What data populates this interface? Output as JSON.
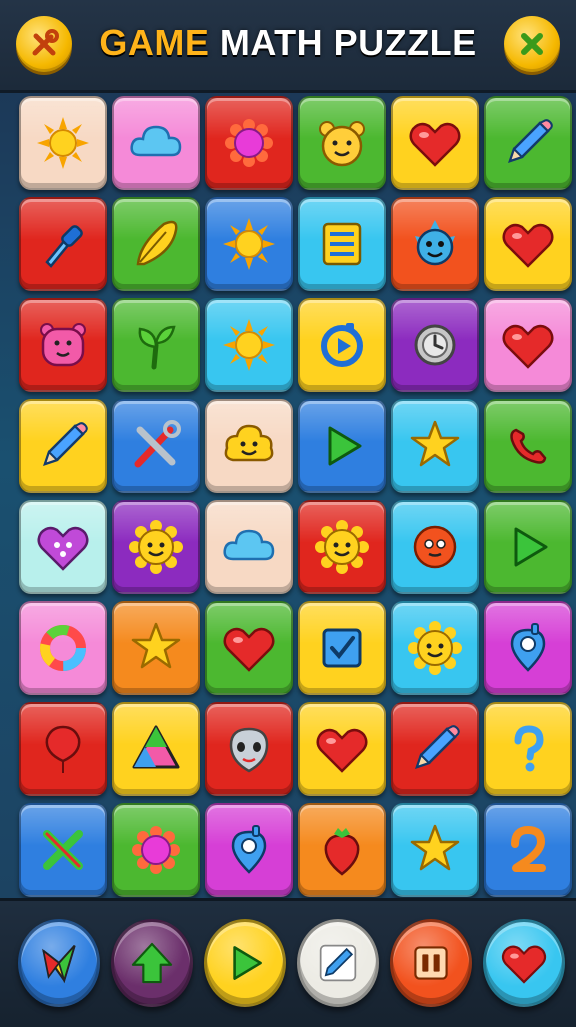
{
  "header": {
    "title_word1": "GAME",
    "title_word2": "MATH PUZZLE",
    "left_button_icon": "tools-icon",
    "right_button_icon": "close-icon"
  },
  "board": {
    "rows": [
      [
        {
          "icon": "sun",
          "color": "#f7d9c4"
        },
        {
          "icon": "cloud",
          "color": "#f58ad8"
        },
        {
          "icon": "flower",
          "color": "#e0261e"
        },
        {
          "icon": "bear-face",
          "color": "#4cb830"
        },
        {
          "icon": "heart",
          "color": "#ffd21f"
        },
        {
          "icon": "pencil",
          "color": "#4cb830"
        }
      ],
      [
        {
          "icon": "dropper",
          "color": "#e0261e"
        },
        {
          "icon": "leaf-pencil",
          "color": "#4cb830"
        },
        {
          "icon": "sun",
          "color": "#2f7fe0"
        },
        {
          "icon": "list",
          "color": "#38c6f0"
        },
        {
          "icon": "monster",
          "color": "#f2521e"
        },
        {
          "icon": "heart",
          "color": "#ffd21f"
        }
      ],
      [
        {
          "icon": "pig-face",
          "color": "#e0261e"
        },
        {
          "icon": "sprout",
          "color": "#4cb830"
        },
        {
          "icon": "sun",
          "color": "#38c6f0"
        },
        {
          "icon": "play-ring",
          "color": "#ffd21f"
        },
        {
          "icon": "clock-ring",
          "color": "#8c2bbf"
        },
        {
          "icon": "heart",
          "color": "#f58ad8"
        }
      ],
      [
        {
          "icon": "pencil",
          "color": "#ffd21f"
        },
        {
          "icon": "tools",
          "color": "#2f7fe0"
        },
        {
          "icon": "smile-cloud",
          "color": "#f7d9c4"
        },
        {
          "icon": "play-arrow",
          "color": "#2f7fe0"
        },
        {
          "icon": "star",
          "color": "#38c6f0"
        },
        {
          "icon": "phone",
          "color": "#4cb830"
        }
      ],
      [
        {
          "icon": "heart-face",
          "color": "#b8f0ec"
        },
        {
          "icon": "sun-face",
          "color": "#8c2bbf"
        },
        {
          "icon": "cloud",
          "color": "#f7d9c4"
        },
        {
          "icon": "sun-face",
          "color": "#e0261e"
        },
        {
          "icon": "ball-face",
          "color": "#38c6f0"
        },
        {
          "icon": "play-arrow",
          "color": "#4cb830"
        }
      ],
      [
        {
          "icon": "donut",
          "color": "#f58ad8"
        },
        {
          "icon": "star",
          "color": "#f58a1e"
        },
        {
          "icon": "heart",
          "color": "#4cb830"
        },
        {
          "icon": "checkbox",
          "color": "#ffd21f"
        },
        {
          "icon": "sun-face",
          "color": "#38c6f0"
        },
        {
          "icon": "pin",
          "color": "#d63fd6"
        }
      ],
      [
        {
          "icon": "balloon",
          "color": "#e0261e"
        },
        {
          "icon": "triangle",
          "color": "#ffd21f"
        },
        {
          "icon": "alien-face",
          "color": "#e0261e"
        },
        {
          "icon": "heart",
          "color": "#ffd21f"
        },
        {
          "icon": "pencil",
          "color": "#e0261e"
        },
        {
          "icon": "question",
          "color": "#ffd21f"
        }
      ],
      [
        {
          "icon": "cross",
          "color": "#2f7fe0"
        },
        {
          "icon": "flower",
          "color": "#4cb830"
        },
        {
          "icon": "pin",
          "color": "#d63fd6"
        },
        {
          "icon": "strawberry",
          "color": "#f58a1e"
        },
        {
          "icon": "star",
          "color": "#38c6f0"
        },
        {
          "icon": "number-two",
          "color": "#2f7fe0"
        }
      ]
    ]
  },
  "footer": {
    "buttons": [
      {
        "icon": "kite",
        "color": "#2f7fe0"
      },
      {
        "icon": "arrow-up",
        "color": "#6b2f6b"
      },
      {
        "icon": "play-arrow",
        "color": "#ffd21f"
      },
      {
        "icon": "pencil-card",
        "color": "#ecebe4"
      },
      {
        "icon": "pause",
        "color": "#f2521e"
      },
      {
        "icon": "heart",
        "color": "#38c6f0"
      }
    ]
  }
}
